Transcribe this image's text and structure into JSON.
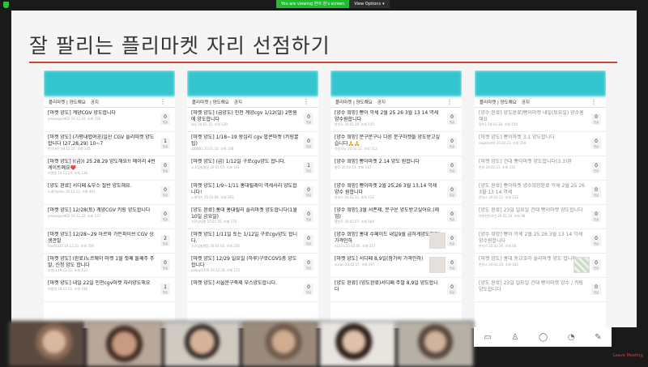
{
  "zoom": {
    "viewing_label": "You are viewing 한아 강's screen",
    "view_options_label": "View Options",
    "leave_label": "Leave Meeting"
  },
  "slide": {
    "title": "잘 팔리는 플리마켓 자리 선점하기"
  },
  "colors": {
    "accent_line": "#d4452f",
    "app_header": "#34c5cf",
    "share_banner": "#25b935"
  },
  "phones": [
    {
      "tabs": [
        "플리마켓 | 양도해요",
        "공지"
      ],
      "posts": [
        {
          "title": "[마켓 양도] 계양CGV 양도합니다",
          "meta": "yeoangood62 19.12.24. 조회 156",
          "count": "0",
          "sub": "댓글"
        },
        {
          "title": "[마켓 양도] (가평내렵여공)일산 CGV 플리마켓 양도합니다 (27,28,29) 10~7",
          "meta": "안다여진 19.12.24. 조회 245",
          "count": "1",
          "sub": "댓글"
        },
        {
          "title": "[마켓 양도] ((급)) 25.28.29 양도해요!! 메이리 4번게이트예요❤️",
          "meta": "이열령 19.12.24. 조회 138",
          "count": "0",
          "sub": "댓글"
        },
        {
          "title": "[양도 완료] 서디페 &부스 절반 양도해요.",
          "meta": "노래꾸ydsu 19.12.23. 조회 493",
          "count": "0",
          "sub": "댓글"
        },
        {
          "title": "[마켓 양도] 12/28(토) 계양CGV 키링 양도합니다",
          "meta": "yeoangood62 19.12.22. 조회 137",
          "count": "0",
          "sub": "댓글"
        },
        {
          "title": "[마켓 양도] 12/28~29 아르와 가든파이브 CGV 상생관발",
          "meta": "food0324 19.12.22. 조회 359",
          "count": "2",
          "sub": "댓글"
        },
        {
          "title": "[마켓 양도] (완료)노르웨이 마켓 1월 첫째 둘째주 주말, 신청 양도 합니다",
          "meta": "추현나 19.12.21. 조회 413",
          "count": "0",
          "sub": "댓글"
        },
        {
          "title": "[마켓 양도] 내일 22일 인천cgv마켓 자리양도해요",
          "meta": "이열령 19.12.21. 조회 194",
          "count": "1",
          "sub": "댓글"
        }
      ]
    },
    {
      "tabs": [
        "플리마켓 | 양도해요",
        "공지"
      ],
      "posts": [
        {
          "title": "[마켓 양도] (급양도) 인천 계양cgv 1/12(일) 2판원에 양도합니다",
          "meta": "ezy 20.01.11. 조회 129",
          "count": "0",
          "sub": "댓글"
        },
        {
          "title": "[마켓 양도] 1/18~19 왕십리 cgv 팝콘마켓 (키링꿀팁)",
          "meta": "zzB881 20.01.10. 조회 148",
          "count": "0",
          "sub": "댓글"
        },
        {
          "title": "[마켓 양도] (급) 1/12일 구로cgv양도 합니다.",
          "meta": "소소잎들행집 20.01.07. 조회 191",
          "count": "1",
          "sub": "댓글"
        },
        {
          "title": "[마켓 양도] 1/9~1/11 홍대릴레이 역세사리 양도합니다!",
          "meta": "노래먹기 20.01.06. 조회 163",
          "count": "0",
          "sub": "댓글"
        },
        {
          "title": "[양도 완료] 홍대 홍대릴리 플리마켓 양도합니다(1월10일 금요일)",
          "meta": "가연상네병 20.01.05. 조회 275",
          "count": "0",
          "sub": "댓글"
        },
        {
          "title": "[마켓 양도] 1/11일 토는 1/12일 구로cgv양도 합니다.",
          "meta": "소소잎들행집 20.01.03. 조회 226",
          "count": "0",
          "sub": "댓글"
        },
        {
          "title": "[마켓 양도] 12/29 일요일 (하루)구로CGV5층 양도합니다",
          "meta": "yoany0709 19.12.28. 조회 172",
          "count": "0",
          "sub": "댓글"
        },
        {
          "title": "[마켓 양도] 서울문구축제 부스양도합니다.",
          "meta": "",
          "count": "0",
          "sub": "댓글"
        }
      ]
    },
    {
      "tabs": [
        "플리마켓 | 양도해요",
        "공지"
      ],
      "posts": [
        {
          "title": "[양수 희망] 빵이 악세 2월 25 26 3월 13 14 역세 양수원합니다",
          "meta": "한지스 20.02.16. 조회 155",
          "count": "0",
          "sub": "댓글"
        },
        {
          "title": "[양수 희망] 문구문구나 다른 문구마켓들 양도받고싶습니다🙏🙏",
          "meta": "하알모닝 20.02.12. 조회 112",
          "count": "0",
          "sub": "댓글"
        },
        {
          "title": "[양수 희망] 빵이마켓 2.14 양도 원합니다",
          "meta": "향루 20.02.11. 조회 137",
          "count": "0",
          "sub": "댓글"
        },
        {
          "title": "[양수 희망] 빵이마켓 2월 25,26 3월 13,14 악세 양수 원합니다",
          "meta": "한지스 20.02.11. 조회 132",
          "count": "0",
          "sub": "댓글"
        },
        {
          "title": "[양수 희망] 3월 서폰제, 문구운 양도받고싶어요.(제업)",
          "meta": "빨판트 20.02.07. 조회 184",
          "count": "0",
          "sub": "댓글"
        },
        {
          "title": "[양수 희망] 홍대 수페이드 내일9월 급하게양도해요!가격인하",
          "meta": "e127a 20.02.06. 조회 217",
          "count": "0",
          "sub": "댓글",
          "thumb": true
        },
        {
          "title": "[마켓 양도] 서디페 8,9일(참가비 가격인하)",
          "meta": "susan 20.02.07. 조회 297",
          "count": "0",
          "sub": "댓글",
          "thumb": true
        },
        {
          "title": "[양도 완료] (양도완료)서디페 주말 8,9일 양도합니다",
          "meta": "",
          "count": "0",
          "sub": "댓글"
        }
      ]
    },
    {
      "tabs": [
        "플리마켓 | 양도해요",
        "공지"
      ],
      "posts": [
        {
          "title": "[양수 완료] 양도완료)빵이마켓 내일(토요일) 양수원해요",
          "meta": "명지1 20.03.18. 조회 150",
          "count": "0",
          "sub": "댓글",
          "grey": true
        },
        {
          "title": "[마켓 양도] 빵이마켓 3.1 양도합니다",
          "meta": "sagakie40 20.02.23. 조회 169",
          "count": "0",
          "sub": "댓글",
          "grey": true
        },
        {
          "title": "[마켓 양도] 건대 빵이마켓 양도합니다(3.3)완",
          "meta": "한지 20.02.23. 조회 232",
          "count": "0",
          "sub": "댓글",
          "grey": true
        },
        {
          "title": "[양도 완료] 빵이마켓 양수희망완료 악세 2월 25 26 3월 13 14 역세",
          "meta": "한지스 20.02.21. 조회 132",
          "count": "0",
          "sub": "댓글",
          "grey": true
        },
        {
          "title": "[양도 완료] 23일 일요일 건대 빵이마켓 양도합니다",
          "meta": "여여한반려견 20.02.20. 조회 88",
          "count": "0",
          "sub": "댓글",
          "grey": true
        },
        {
          "title": "[양수 희망] 빵이 악세 2월 25 26 3월 13 14 악세 양수원합니다",
          "meta": "한지스 20.02.20. 조회 64",
          "count": "0",
          "sub": "댓글",
          "grey": true
        },
        {
          "title": "[마켓 양도] 홍대 동교호라 플리마켓 양도 합니다",
          "meta": "한지스 20.02.20. 조회 182",
          "count": "0",
          "sub": "댓글",
          "grey": true,
          "thumb": true
        },
        {
          "title": "[양도 완료] 23일 일요일 건대 빵이마켓 양수 / 키링 양도합니다",
          "meta": "",
          "count": "0",
          "sub": "댓글",
          "grey": true
        }
      ]
    }
  ],
  "phone_toolbar": {
    "icons": [
      "home-icon",
      "members-icon",
      "chat-icon",
      "notification-icon",
      "write-icon"
    ]
  }
}
